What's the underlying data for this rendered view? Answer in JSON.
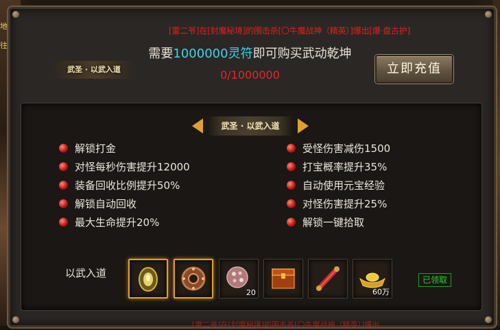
{
  "ticker": {
    "top": "[雷二爷]在[封魔秘境]的围击杀[〇牛魔战神（精英）]爆出[爆·盘古护]",
    "bottom": "[雷二爷]在[封魔秘境]的围击杀[〇牛魔战神（精英）]爆出"
  },
  "side": {
    "t1": "地",
    "t2": "往"
  },
  "header": {
    "banner": "武圣 · 以武入道"
  },
  "requirement": {
    "prefix": "需要",
    "amount": "1000000灵符",
    "suffix": "即可购买武动乾坤",
    "progress": "0/1000000"
  },
  "recharge_button": "立即充值",
  "tier": {
    "title": "武圣 · 以武入道"
  },
  "benefits_left": [
    "解锁打金",
    "对怪每秒伤害提升12000",
    "装备回收比例提升50%",
    "解锁自动回收",
    "最大生命提升20%"
  ],
  "benefits_right": [
    "受怪伤害减伤1500",
    "打宝概率提升35%",
    "自动使用元宝经验",
    "对怪伤害提升25%",
    "解锁一键拾取"
  ],
  "rewards": {
    "label": "以武入道",
    "claimed": "已领取",
    "items": [
      {
        "icon": "golden-seal-icon",
        "count": ""
      },
      {
        "icon": "bronze-ring-icon",
        "count": ""
      },
      {
        "icon": "pink-gem-orb-icon",
        "count": "20"
      },
      {
        "icon": "treasure-chest-icon",
        "count": ""
      },
      {
        "icon": "scroll-icon",
        "count": ""
      },
      {
        "icon": "gold-ingot-icon",
        "count": "60万"
      }
    ]
  },
  "colors": {
    "amount": "#3fd4e8",
    "progress": "#e02828",
    "ticker": "#e02020",
    "accent": "#e0a030",
    "claimed": "#30d030"
  }
}
